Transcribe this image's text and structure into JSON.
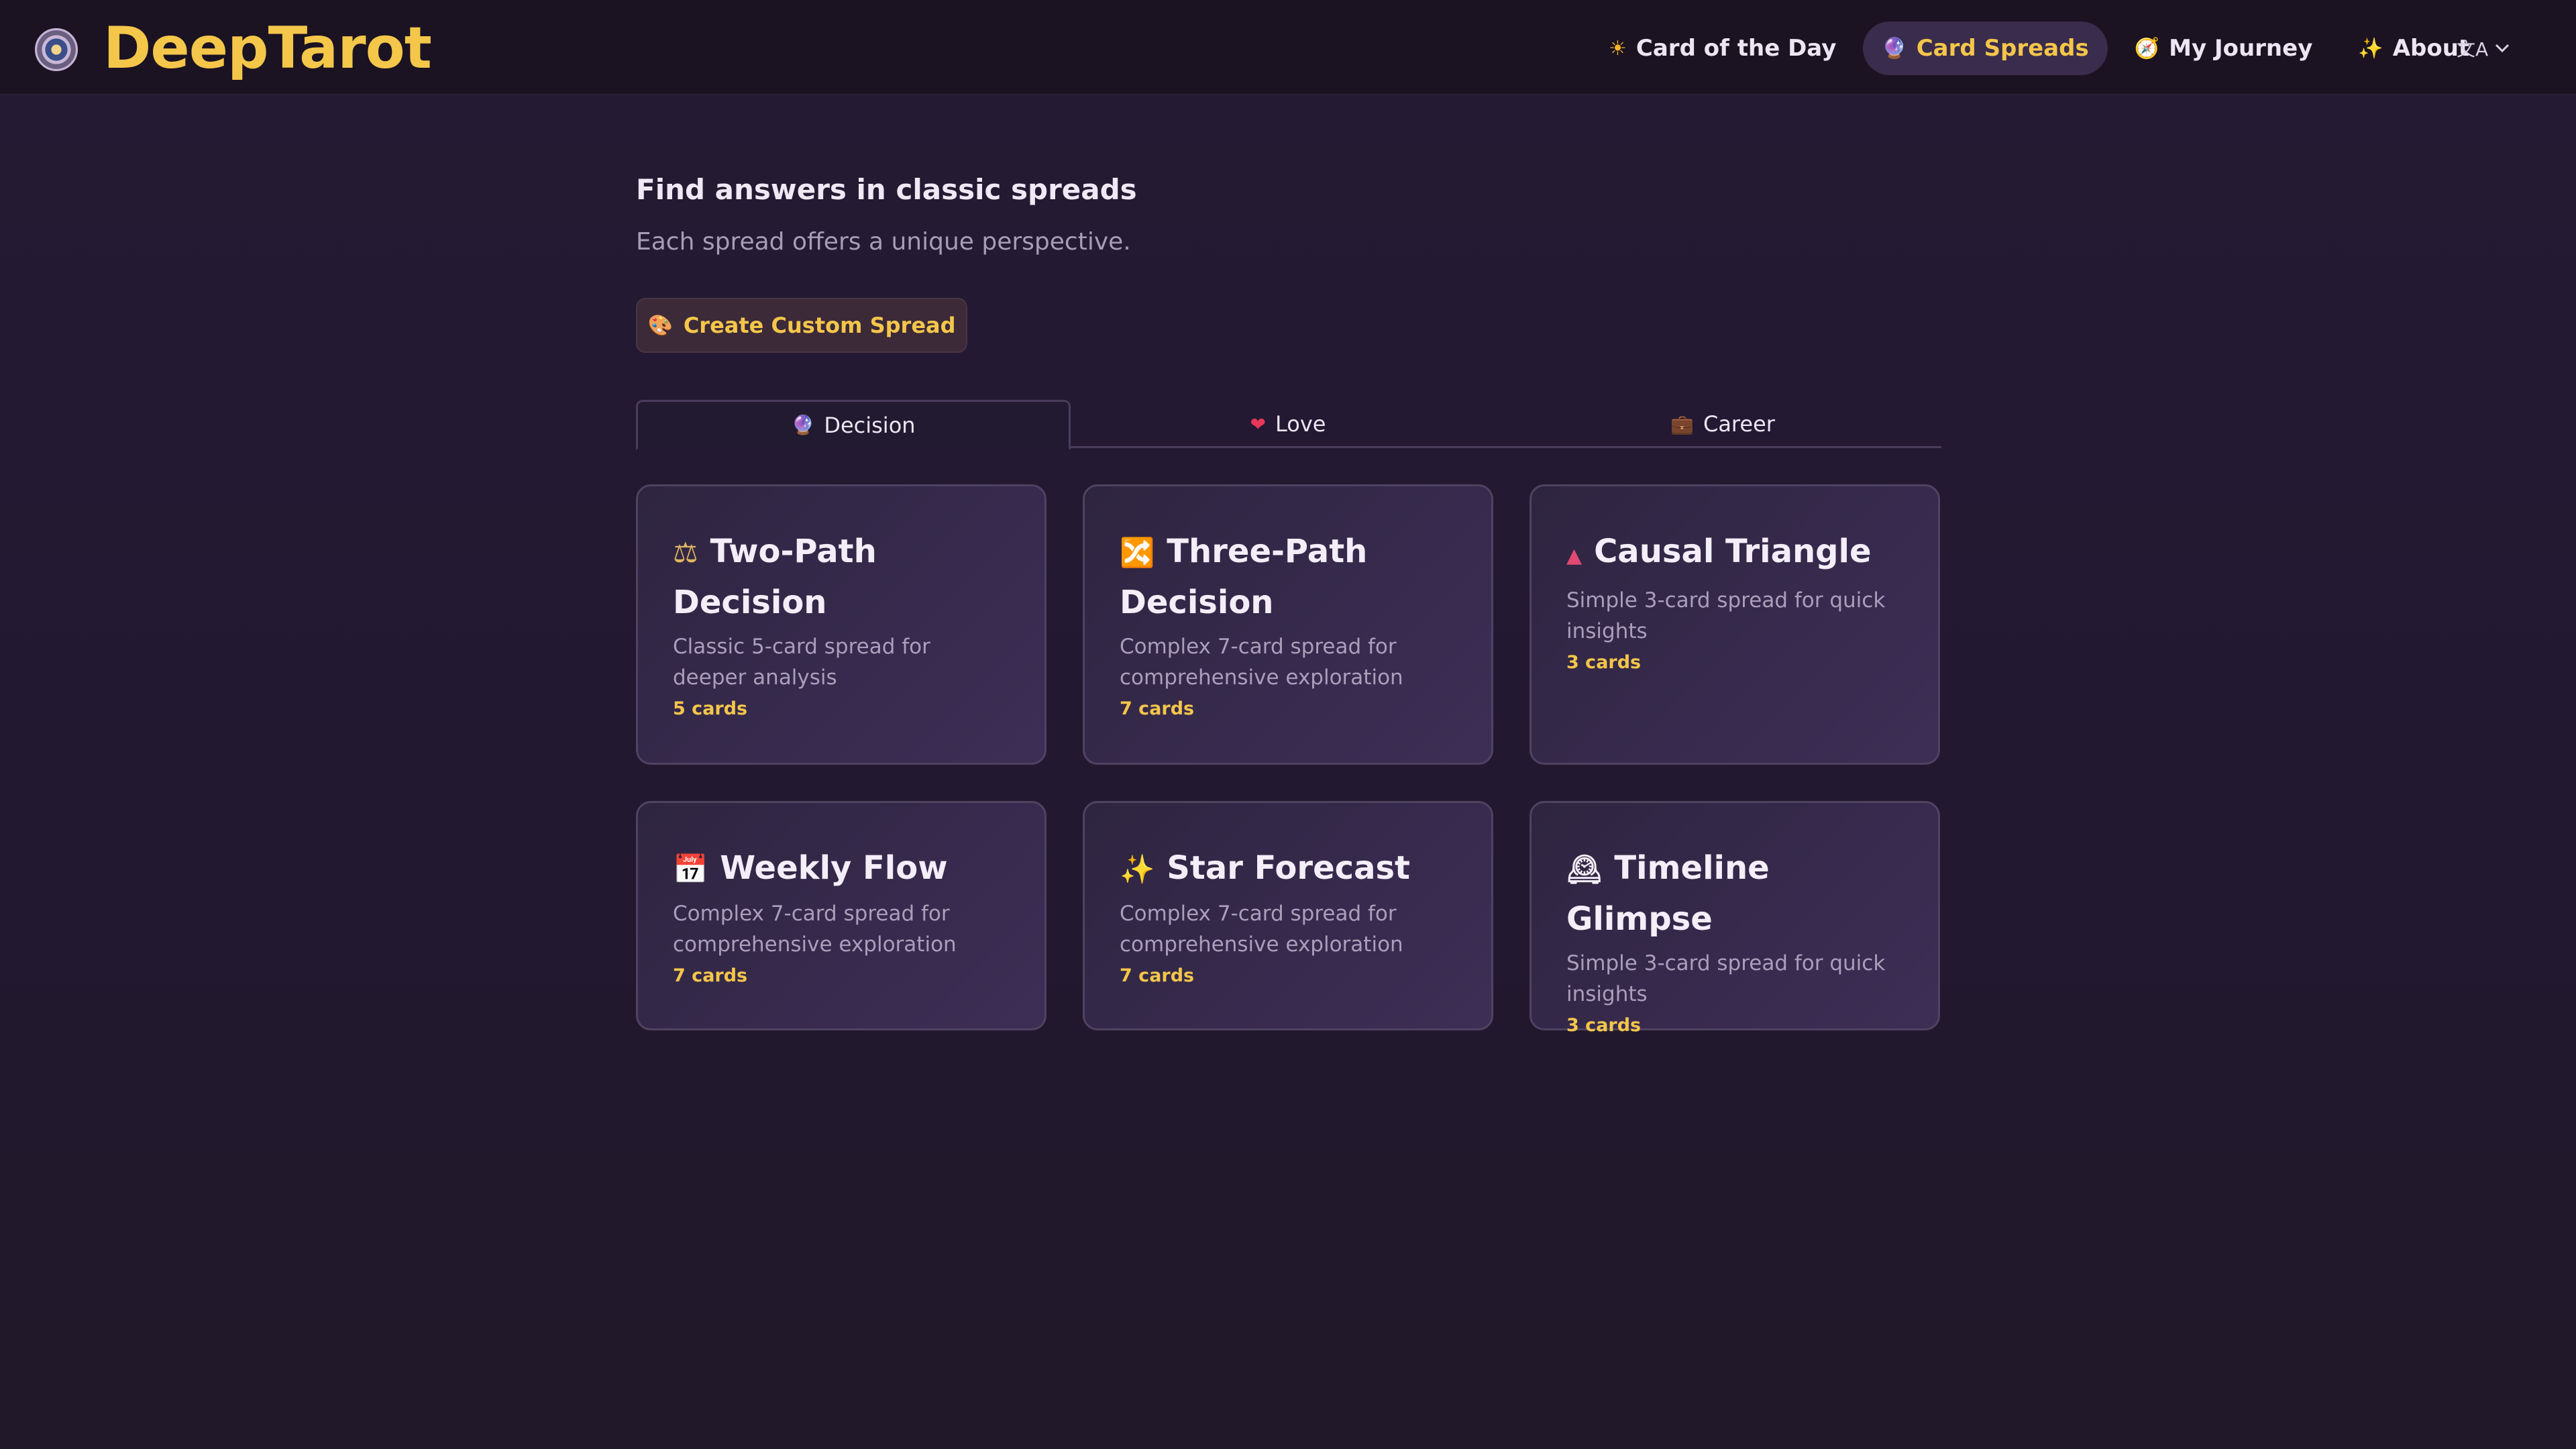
{
  "brand": {
    "name": "DeepTarot",
    "logo_icon": "crystal-globe-icon"
  },
  "nav": {
    "items": [
      {
        "label": "Card of the Day",
        "icon": "☀",
        "active": false
      },
      {
        "label": "Card Spreads",
        "icon": "🔮",
        "active": true
      },
      {
        "label": "My Journey",
        "icon": "🧭",
        "active": false
      },
      {
        "label": "About",
        "icon": "✨",
        "active": false
      }
    ],
    "language_icon": "文A"
  },
  "intro": {
    "title": "Find answers in classic spreads",
    "subtitle": "Each spread offers a unique perspective."
  },
  "custom_button": {
    "label": "Create Custom Spread",
    "icon": "🎨"
  },
  "tabs": [
    {
      "label": "Decision",
      "icon": "🔮",
      "active": true
    },
    {
      "label": "Love",
      "icon": "❤",
      "active": false
    },
    {
      "label": "Career",
      "icon": "💼",
      "active": false
    }
  ],
  "cards": [
    {
      "icon": "⚖",
      "title": "Two-Path Decision",
      "desc": "Classic 5-card spread for deeper analysis",
      "count": "5 cards"
    },
    {
      "icon": "🔀",
      "title": "Three-Path Decision",
      "desc": "Complex 7-card spread for comprehensive exploration",
      "count": "7 cards"
    },
    {
      "icon": "▲",
      "title": "Causal Triangle",
      "desc": "Simple 3-card spread for quick insights",
      "count": "3 cards"
    },
    {
      "icon": "📅",
      "title": "Weekly Flow",
      "desc": "Complex 7-card spread for comprehensive exploration",
      "count": "7 cards"
    },
    {
      "icon": "✨",
      "title": "Star Forecast",
      "desc": "Complex 7-card spread for comprehensive exploration",
      "count": "7 cards"
    },
    {
      "icon": "🕰",
      "title": "Timeline Glimpse",
      "desc": "Simple 3-card spread for quick insights",
      "count": "3 cards"
    }
  ],
  "colors": {
    "accent": "#f4c64a",
    "background": "#231a30",
    "header": "#1b1322"
  }
}
